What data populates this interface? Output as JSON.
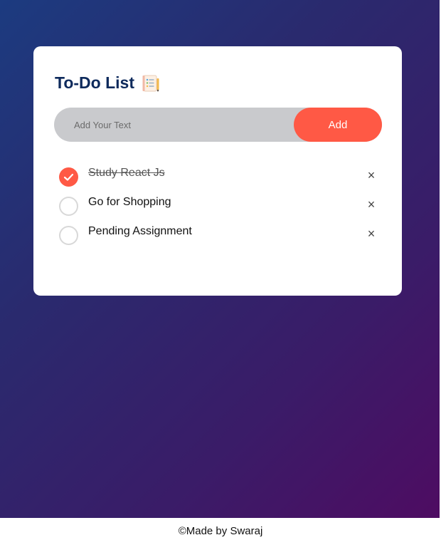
{
  "app": {
    "title": "To-Do List",
    "title_icon": "notepad-list-icon"
  },
  "input": {
    "placeholder": "Add Your Text",
    "value": "",
    "add_label": "Add"
  },
  "todos": [
    {
      "text": "Study React Js",
      "done": true
    },
    {
      "text": "Go for Shopping",
      "done": false
    },
    {
      "text": "Pending Assignment",
      "done": false
    }
  ],
  "remove_glyph": "×",
  "footer": {
    "text": "©Made by Swaraj"
  },
  "colors": {
    "accent": "#ff5945",
    "title": "#0e2a5c",
    "gradient_start": "#1c3b80",
    "gradient_end": "#4e0c62"
  }
}
